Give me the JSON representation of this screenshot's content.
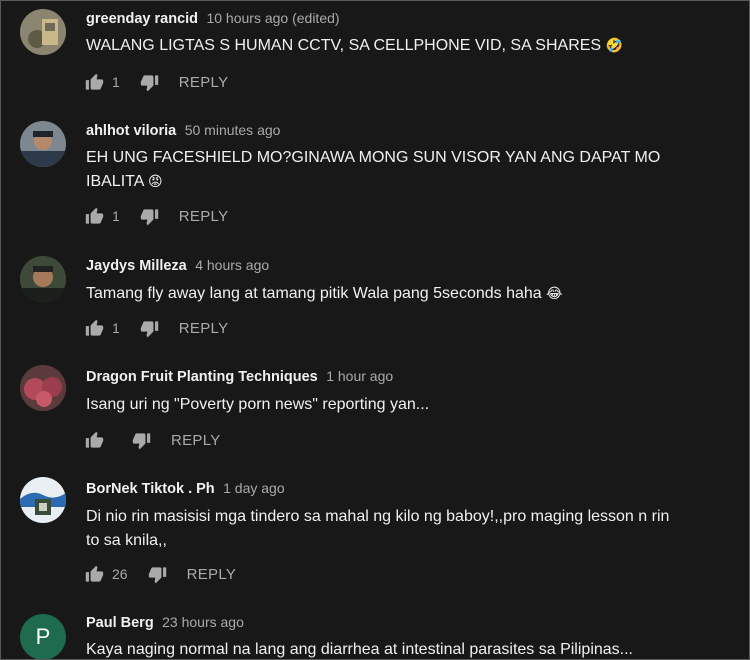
{
  "comments": [
    {
      "author": "greenday rancid",
      "time": "10 hours ago (edited)",
      "text": "WALANG LIGTAS S HUMAN CCTV, SA CELLPHONE VID, SA SHARES",
      "emoji": "🤣",
      "likes": "1",
      "reply": "REPLY",
      "avatar": "photo-avatar"
    },
    {
      "author": "ahlhot viloria",
      "time": "50 minutes ago",
      "text": "EH UNG FACESHIELD MO?GINAWA MONG SUN VISOR YAN ANG DAPAT MO IBALITA",
      "emoji": "😡",
      "likes": "1",
      "reply": "REPLY",
      "avatar": "photo-avatar"
    },
    {
      "author": "Jaydys Milleza",
      "time": "4 hours ago",
      "text": "Tamang fly away lang at tamang pitik Wala pang 5seconds haha",
      "emoji": "😂",
      "likes": "1",
      "reply": "REPLY",
      "avatar": "photo-avatar"
    },
    {
      "author": "Dragon Fruit Planting Techniques",
      "time": "1 hour ago",
      "text": "Isang uri ng \"Poverty porn news\" reporting yan...",
      "emoji": "",
      "likes": "",
      "reply": "REPLY",
      "avatar": "photo-avatar"
    },
    {
      "author": "BorNek Tiktok . Ph",
      "time": "1 day ago",
      "text": "Di nio rin masisisi mga tindero sa mahal ng kilo ng baboy!,,pro maging lesson n rin to sa knila,,",
      "emoji": "",
      "likes": "26",
      "reply": "REPLY",
      "avatar": "logo-avatar"
    },
    {
      "author": "Paul Berg",
      "time": "23 hours ago",
      "text": "Kaya naging normal na lang ang diarrhea at intestinal parasites sa Pilipinas...",
      "emoji": "",
      "likes": "",
      "reply": "REPLY",
      "avatar": "letter-avatar",
      "avatar_letter": "P"
    }
  ],
  "colors": {
    "background": "#181818",
    "text": "#f1f1f1",
    "secondary": "#aaaaaa",
    "letter_avatar": "#1f6b4e"
  },
  "icons": [
    "thumbs-up-icon",
    "thumbs-down-icon"
  ]
}
